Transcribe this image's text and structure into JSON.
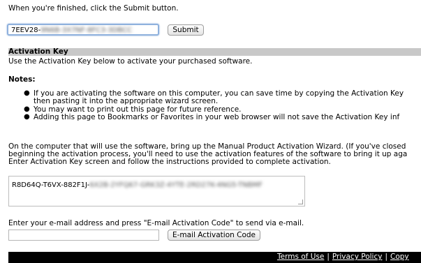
{
  "top_instruction": "When you're finished, click the Submit button.",
  "key_field": {
    "prefix": "7EEV28-",
    "obscured": "9N6B-3X7NF-8FC3-3DBCC"
  },
  "submit_label": "Submit",
  "section": {
    "title": "Activation Key",
    "description": "Use the Activation Key below to activate your purchased software."
  },
  "notes_label": "Notes:",
  "notes": [
    {
      "line1": "If you are activating the software on this computer, you can save time by copying the Activation Key",
      "line2": "then pasting it into the appropriate wizard screen."
    },
    {
      "line1": "You may want to print out this page for future reference."
    },
    {
      "line1": "Adding this page to Bookmarks or Favorites in your web browser will not save the Activation Key inf"
    }
  ],
  "paragraph": [
    "On the computer that will use the software, bring up the Manual Product Activation Wizard. (If you've closed",
    "beginning the activation process, you'll need to use the activation features of the software to bring it up aga",
    "Enter Activation Key screen and follow the instructions provided to complete activation."
  ],
  "activation_key": {
    "prefix": "R8D64Q-T6VX-882F1J-",
    "obscured": "6X2B-2YFQ67-GRK3Z-4YTE-2RD27K-4NG5-TNBMF"
  },
  "email_prompt": "Enter your e-mail address and press \"E-mail Activation Code\" to send via e-mail.",
  "email_input_value": "",
  "email_button_label": "E-mail Activation Code",
  "footer": {
    "terms": "Terms of Use",
    "privacy": "Privacy Policy",
    "copy": "Copy",
    "separator": "|"
  }
}
